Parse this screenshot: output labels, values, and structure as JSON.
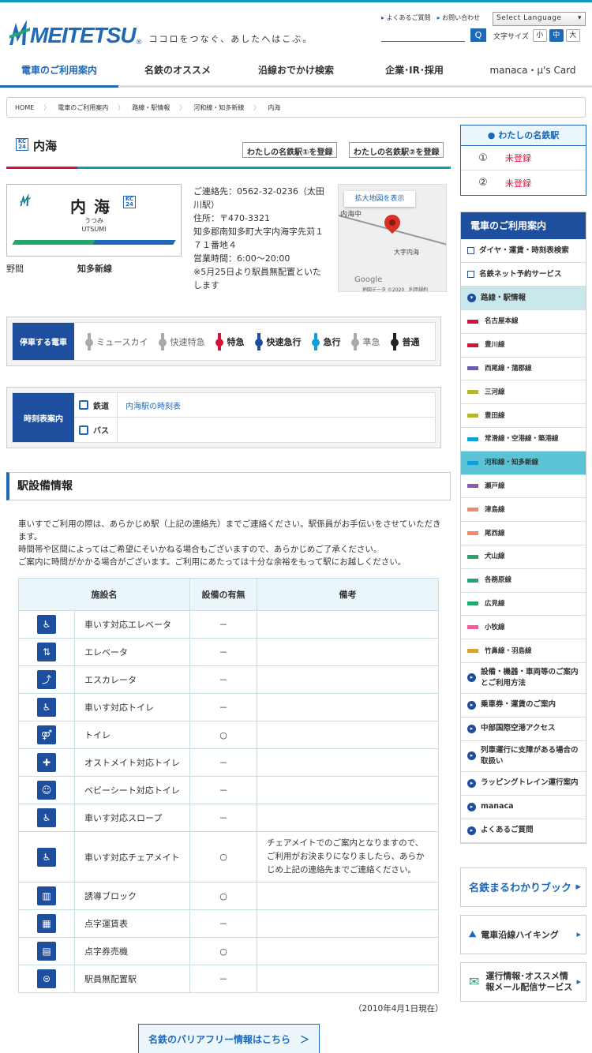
{
  "header": {
    "logo_text": "MEITETSU",
    "tagline": "ココロをつなぐ、あしたへはこぶ。",
    "links": [
      "よくあるご質問",
      "お問い合わせ"
    ],
    "language": "Select Language",
    "search_button": "Q",
    "font_size_label": "文字サイズ",
    "font_sizes": [
      "小",
      "中",
      "大"
    ]
  },
  "gnav": [
    "電車のご利用案内",
    "名鉄のオススメ",
    "沿線おでかけ検索",
    "企業･IR･採用",
    "manaca・μ's Card"
  ],
  "breadcrumb": [
    "HOME",
    "電車のご利用案内",
    "路線・駅情報",
    "河和線・知多新線",
    "内海"
  ],
  "station": {
    "badge_line": "KC",
    "badge_num": "24",
    "name": "内海",
    "sign_name": "内海",
    "kana": "うつみ",
    "roman": "UTSUMI",
    "register1": "わたしの名鉄駅①を登録",
    "register2": "わたしの名鉄駅②を登録",
    "adjacent_left": "野間",
    "line_name": "知多新線",
    "info": [
      "ご連絡先：0562-32-0236（太田川駅）",
      "住所：〒470-3321",
      "知多郡南知多町大字内海字先苅１７１番地４",
      "営業時間：6:00～20:00",
      "※5月25日より駅員無配置といたします"
    ],
    "map_button": "拡大地図を表示",
    "map_labels": [
      "内海中",
      "大字内海",
      "Google",
      "地図データ ©2020　利用規約"
    ]
  },
  "stops": {
    "label": "停車する電車",
    "items": [
      {
        "name": "ミュースカイ",
        "color": "#aaaaaa",
        "bold": false
      },
      {
        "name": "快速特急",
        "color": "#aaaaaa",
        "bold": false
      },
      {
        "name": "特急",
        "color": "#d7123a",
        "bold": true
      },
      {
        "name": "快速急行",
        "color": "#1e4f9e",
        "bold": true
      },
      {
        "name": "急行",
        "color": "#0ea0dc",
        "bold": true
      },
      {
        "name": "準急",
        "color": "#aaaaaa",
        "bold": false
      },
      {
        "name": "普通",
        "color": "#222222",
        "bold": true
      }
    ]
  },
  "timetable": {
    "label": "時刻表案内",
    "rail_label": "鉄道",
    "rail_link": "内海駅の時刻表",
    "bus_label": "バス"
  },
  "facilities": {
    "heading": "駅設備情報",
    "notes": [
      "車いすでご利用の際は、あらかじめ駅（上記の連絡先）までご連絡ください。駅係員がお手伝いをさせていただきます。",
      "時間帯や区間によってはご希望にそいかねる場合もございますので、あらかじめご了承ください。",
      "ご案内に時間がかかる場合がございます。ご利用にあたっては十分な余裕をもって駅にお越しください。"
    ],
    "columns": [
      "施設名",
      "設備の有無",
      "備考"
    ],
    "rows": [
      {
        "icon": "wheelchair-elevator-icon",
        "glyph": "♿",
        "name": "車いす対応エレベータ",
        "has": "－",
        "note": ""
      },
      {
        "icon": "elevator-icon",
        "glyph": "⇅",
        "name": "エレベータ",
        "has": "－",
        "note": ""
      },
      {
        "icon": "escalator-icon",
        "glyph": "⤴",
        "name": "エスカレータ",
        "has": "－",
        "note": ""
      },
      {
        "icon": "wheelchair-toilet-icon",
        "glyph": "♿",
        "name": "車いす対応トイレ",
        "has": "－",
        "note": ""
      },
      {
        "icon": "toilet-icon",
        "glyph": "⚤",
        "name": "トイレ",
        "has": "○",
        "note": ""
      },
      {
        "icon": "ostomate-toilet-icon",
        "glyph": "✚",
        "name": "オストメイト対応トイレ",
        "has": "－",
        "note": ""
      },
      {
        "icon": "baby-seat-toilet-icon",
        "glyph": "☺",
        "name": "ベビーシート対応トイレ",
        "has": "－",
        "note": ""
      },
      {
        "icon": "wheelchair-slope-icon",
        "glyph": "♿",
        "name": "車いす対応スロープ",
        "has": "－",
        "note": ""
      },
      {
        "icon": "chairmate-icon",
        "glyph": "♿",
        "name": "車いす対応チェアメイト",
        "has": "○",
        "note": "チェアメイトでのご案内となりますので、ご利用がお決まりになりましたら、あらかじめ上記の連絡先までご連絡ください。"
      },
      {
        "icon": "guide-block-icon",
        "glyph": "▥",
        "name": "誘導ブロック",
        "has": "○",
        "note": ""
      },
      {
        "icon": "braille-fare-table-icon",
        "glyph": "▦",
        "name": "点字運賃表",
        "has": "－",
        "note": ""
      },
      {
        "icon": "braille-ticket-machine-icon",
        "glyph": "▤",
        "name": "点字券売機",
        "has": "○",
        "note": ""
      },
      {
        "icon": "unstaffed-station-icon",
        "glyph": "⊜",
        "name": "駅員無配置駅",
        "has": "－",
        "note": ""
      }
    ],
    "date": "（2010年4月1日現在）",
    "barrier_free_link": "名鉄のバリアフリー情報はこちら　＞"
  },
  "my_station": {
    "heading": "わたしの名鉄駅",
    "rows": [
      {
        "num": "①",
        "value": "未登録"
      },
      {
        "num": "②",
        "value": "未登録"
      }
    ]
  },
  "side_nav": {
    "heading": "電車のご利用案内",
    "items": [
      {
        "label": "ダイヤ・運賃・時刻表検索",
        "kind": "ext"
      },
      {
        "label": "名鉄ネット予約サービス",
        "kind": "ext"
      },
      {
        "label": "路線・駅情報",
        "kind": "open"
      },
      {
        "label": "名古屋本線",
        "kind": "line",
        "color": "#d7123a"
      },
      {
        "label": "豊川線",
        "kind": "line",
        "color": "#d7123a"
      },
      {
        "label": "西尾線・蒲郡線",
        "kind": "line",
        "color": "#6a5ca8"
      },
      {
        "label": "三河線",
        "kind": "line",
        "color": "#b5b82a"
      },
      {
        "label": "豊田線",
        "kind": "line",
        "color": "#b5b82a"
      },
      {
        "label": "常滑線・空港線・築港線",
        "kind": "line",
        "color": "#0ea0dc"
      },
      {
        "label": "河和線・知多新線",
        "kind": "line",
        "color": "#0ea0dc"
      },
      {
        "label": "瀬戸線",
        "kind": "line",
        "color": "#8a5ca8"
      },
      {
        "label": "津島線",
        "kind": "line",
        "color": "#ee8a6a"
      },
      {
        "label": "尾西線",
        "kind": "line",
        "color": "#ee8a6a"
      },
      {
        "label": "犬山線",
        "kind": "line",
        "color": "#22a66e"
      },
      {
        "label": "各務原線",
        "kind": "line",
        "color": "#22a66e"
      },
      {
        "label": "広見線",
        "kind": "line",
        "color": "#22a66e"
      },
      {
        "label": "小牧線",
        "kind": "line",
        "color": "#e8609a"
      },
      {
        "label": "竹鼻線・羽島線",
        "kind": "line",
        "color": "#d4a43a"
      },
      {
        "label": "設備・機器・車両等のご案内とご利用方法",
        "kind": "arrow"
      },
      {
        "label": "乗車券・運賃のご案内",
        "kind": "arrow"
      },
      {
        "label": "中部国際空港アクセス",
        "kind": "arrow"
      },
      {
        "label": "列車運行に支障がある場合の取扱い",
        "kind": "arrow"
      },
      {
        "label": "ラッピングトレイン運行案内",
        "kind": "arrow"
      },
      {
        "label": "manaca",
        "kind": "arrow"
      },
      {
        "label": "よくあるご質問",
        "kind": "arrow"
      }
    ]
  },
  "banners": [
    "名鉄まるわかりブック",
    "電車沿線ハイキング",
    "運行情報･オススメ情報メール配信サービス"
  ]
}
